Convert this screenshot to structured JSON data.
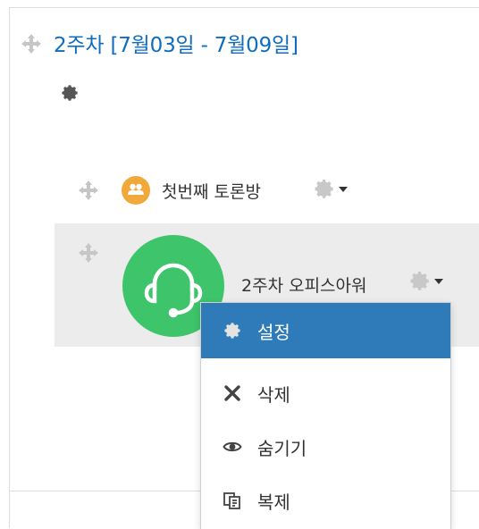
{
  "section": {
    "title": "2주차 [7월03일 - 7월09일]"
  },
  "activities": [
    {
      "name": "첫번째 토론방",
      "icon": "forum-icon",
      "icon_color": "#f0a93a"
    },
    {
      "name": "2주차 오피스아워",
      "icon": "headset-icon",
      "icon_color": "#3ec46a"
    }
  ],
  "menu": {
    "items": [
      {
        "label": "설정",
        "icon": "gear-icon",
        "active": true
      },
      {
        "label": "삭제",
        "icon": "close-icon",
        "active": false
      },
      {
        "label": "숨기기",
        "icon": "eye-icon",
        "active": false
      },
      {
        "label": "복제",
        "icon": "copy-icon",
        "active": false
      }
    ]
  },
  "colors": {
    "link": "#0f6cbf",
    "menu_active": "#2f7ab8",
    "row_highlight": "#ececec"
  }
}
